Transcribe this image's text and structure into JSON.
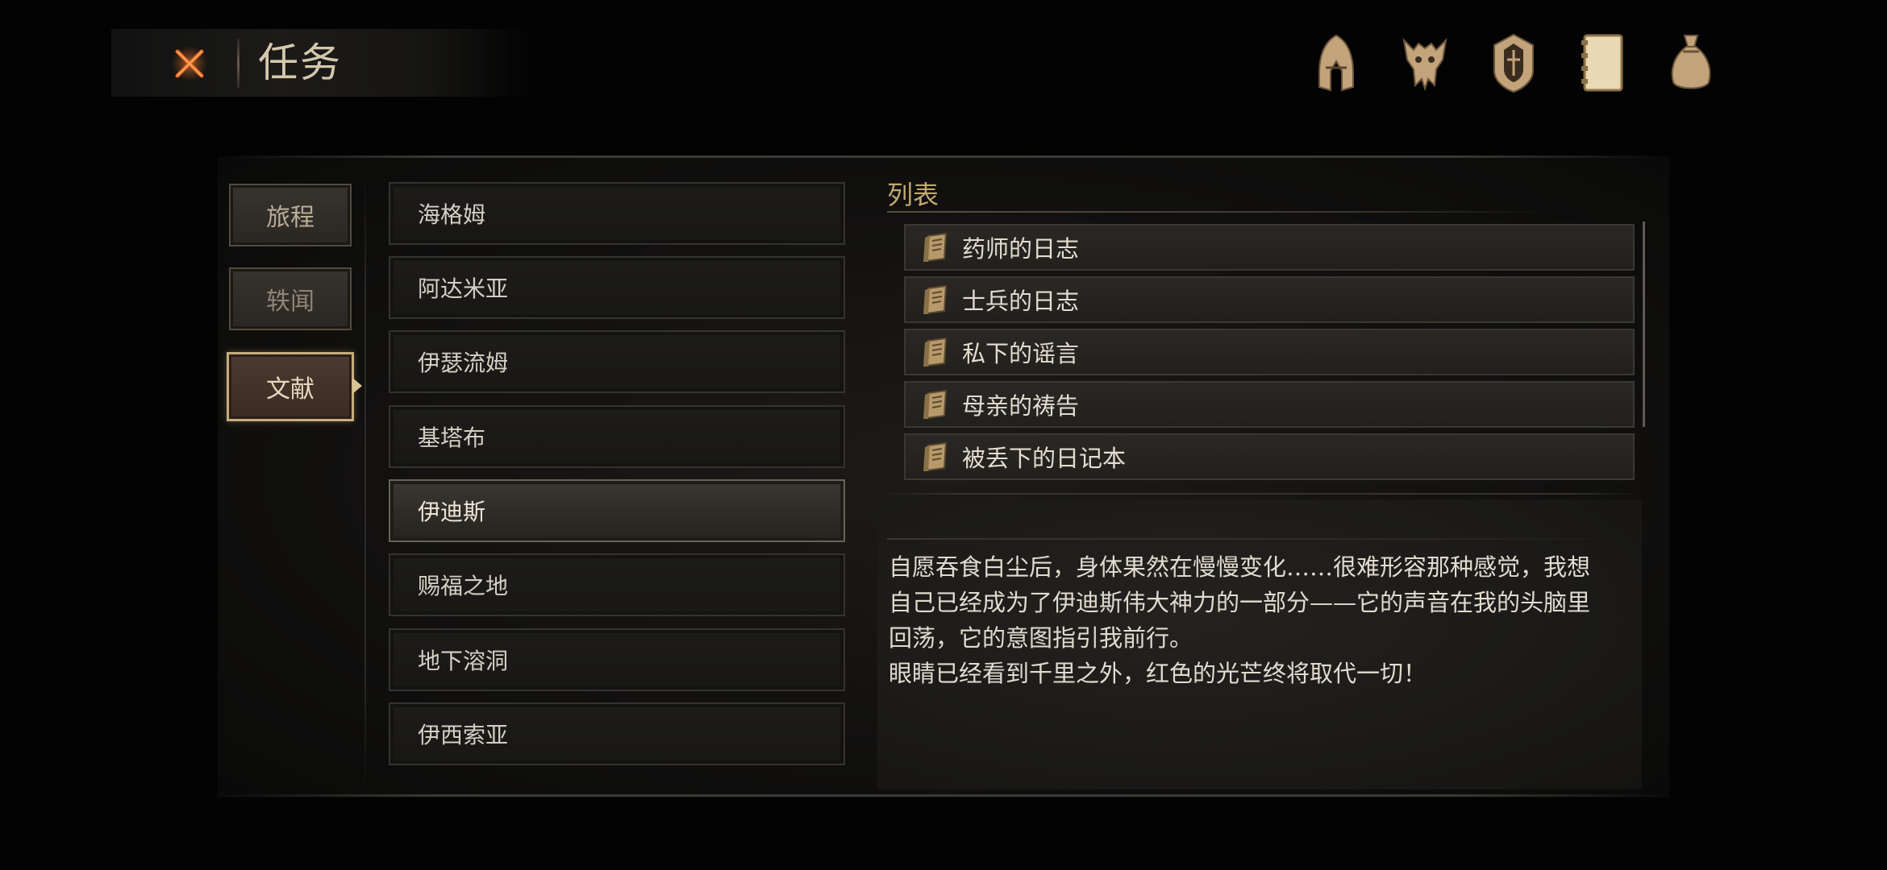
{
  "header": {
    "title": "任务",
    "close_icon": "close-x-icon",
    "top_icons": [
      "helmet-icon",
      "beast-mask-icon",
      "emblem-shield-icon",
      "journal-book-icon",
      "money-bag-icon"
    ]
  },
  "categories": [
    {
      "label": "旅程",
      "active": false
    },
    {
      "label": "轶闻",
      "active": false
    },
    {
      "label": "文献",
      "active": true
    }
  ],
  "locations": [
    {
      "label": "海格姆",
      "selected": false
    },
    {
      "label": "阿达米亚",
      "selected": false
    },
    {
      "label": "伊瑟流姆",
      "selected": false
    },
    {
      "label": "基塔布",
      "selected": false
    },
    {
      "label": "伊迪斯",
      "selected": true
    },
    {
      "label": "赐福之地",
      "selected": false
    },
    {
      "label": "地下溶洞",
      "selected": false
    },
    {
      "label": "伊西索亚",
      "selected": false
    }
  ],
  "list": {
    "title": "列表",
    "items": [
      {
        "label": "药师的日志",
        "icon": "scroll-icon"
      },
      {
        "label": "士兵的日志",
        "icon": "scroll-icon"
      },
      {
        "label": "私下的谣言",
        "icon": "scroll-icon"
      },
      {
        "label": "母亲的祷告",
        "icon": "scroll-icon"
      },
      {
        "label": "被丢下的日记本",
        "icon": "scroll-icon"
      }
    ]
  },
  "description": "自愿吞食白尘后，身体果然在慢慢变化……很难形容那种感觉，我想\n自己已经成为了伊迪斯伟大神力的一部分——它的声音在我的头脑里\n回荡，它的意图指引我前行。\n眼睛已经看到千里之外，红色的光芒终将取代一切！",
  "colors": {
    "accent_gold": "#c2a870",
    "close_orange": "#e0651f"
  }
}
